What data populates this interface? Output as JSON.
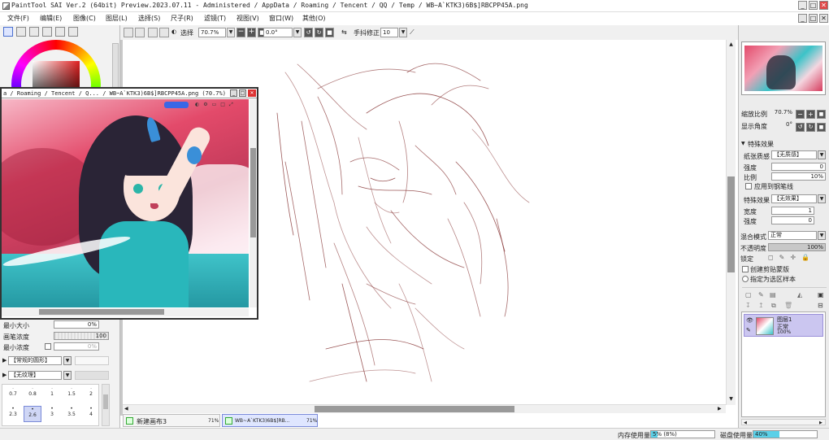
{
  "window": {
    "title": "PaintTool SAI Ver.2 (64bit) Preview.2023.07.11 - Administered / AppData / Roaming / Tencent / QQ / Temp / WB~A`KTK3)6B$]RBCPP45A.png",
    "minimize": "_",
    "maximize": "□",
    "close": "✕"
  },
  "menu": [
    "文件(F)",
    "编辑(E)",
    "图像(C)",
    "图层(L)",
    "选择(S)",
    "尺子(R)",
    "滤镜(T)",
    "视图(V)",
    "窗口(W)",
    "其他(O)"
  ],
  "toolbar": {
    "select_label": "选择",
    "zoom": "70.7%",
    "rotation": "0.0°",
    "stabilizer_label": "手抖修正",
    "stabilizer_value": "10"
  },
  "left_panel": {
    "min_size_label": "最小大小",
    "min_size_value": "0%",
    "brush_density_label": "画笔浓度",
    "brush_density_value": "100",
    "min_density_label": "最小浓度",
    "min_density_value": "0%",
    "shape_dropdown": "【常规的圆形】",
    "texture_dropdown": "【无纹理】",
    "sizes_row1": [
      "0.7",
      "0.8",
      "1",
      "1.5",
      "2"
    ],
    "sizes_row2": [
      "2.3",
      "2.6",
      "3",
      "3.5",
      "4"
    ]
  },
  "floating_window": {
    "title": "a / Roaming / Tencent / Q... / WB~A`KTK3)6B$]RBCPP45A.png (70.7%)"
  },
  "canvas": {
    "sketch_color": "#8a3a3a"
  },
  "right_panel": {
    "zoom_label": "缩放比例",
    "zoom_value": "70.7%",
    "angle_label": "显示角度",
    "angle_value": "0°",
    "effects_header": "特殊效果",
    "paper_label": "纸张质感",
    "paper_value": "【无质感】",
    "strength_label": "强度",
    "strength_value": "0",
    "scale_label": "比例",
    "scale_value": "10%",
    "apply_brush_label": "应用到钢笔线",
    "effect_label": "特殊效果",
    "effect_value": "【无效果】",
    "width_label": "宽度",
    "width_value": "1",
    "strength2_label": "强度",
    "strength2_value": "0",
    "blend_label": "混合模式",
    "blend_value": "正常",
    "opacity_label": "不透明度",
    "opacity_value": "100%",
    "lock_label": "锁定",
    "clip_label": "创建剪贴蒙版",
    "sample_label": "指定为选区样本",
    "layer_name": "图层1",
    "layer_mode": "正常",
    "layer_opacity": "100%"
  },
  "tabs": [
    {
      "label": "新建画布3",
      "zoom": "71%"
    },
    {
      "label": "WB~A`KTK3)6B$]RB...",
      "zoom": "71%"
    }
  ],
  "status": {
    "memory_label": "内存使用量",
    "memory_value": "5% (8%)",
    "disk_label": "磁盘使用量",
    "disk_value": "40%"
  }
}
